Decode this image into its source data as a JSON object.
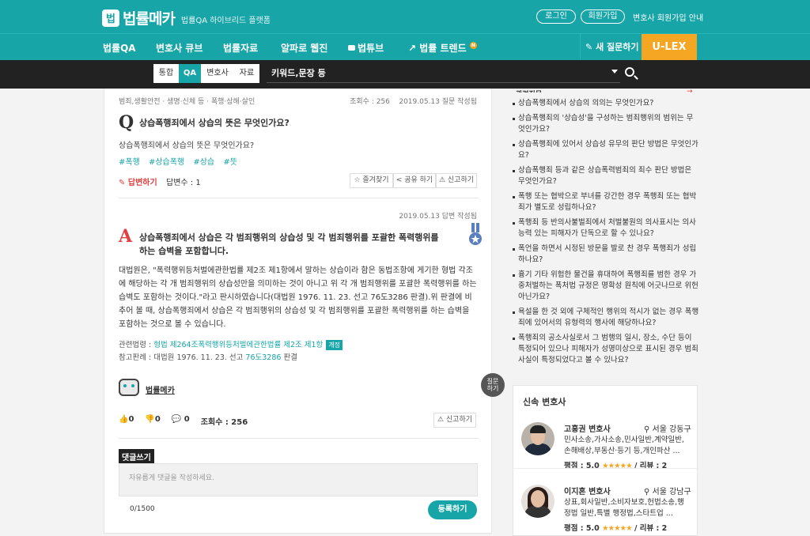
{
  "header": {
    "logo_mark": "법",
    "logo_text": "법률메카",
    "logo_sub": "법률QA 하이브리드 플랫폼",
    "login": "로그인",
    "signup": "회원가입",
    "lawyer_signup": "변호사 회원가입 안내"
  },
  "nav": {
    "items": [
      "법률QA",
      "변호사 큐브",
      "법률자료",
      "알파로 웹진",
      "법튜브",
      "법률 트렌드"
    ],
    "new_badge": "N",
    "write": "새 질문하기",
    "ulex": "U-LEX"
  },
  "search": {
    "tabs": [
      "통합",
      "QA",
      "변호사",
      "자료"
    ],
    "active_tab": "QA",
    "placeholder": "키워드,문장 등"
  },
  "question": {
    "breadcrumb": "범죄,생활안전 · 생명·신체 등 · 폭행·상해·살인",
    "views": "조회수 : 256",
    "date": "2019.05.13 질문 작성됨",
    "mark": "Q",
    "title": "상습폭행죄에서 상습의 뜻은 무엇인가요?",
    "body": "상습폭행죄에서 상습의 뜻은 무엇인가요?",
    "tags": [
      "#폭행",
      "#상습폭행",
      "#상습",
      "#뜻"
    ],
    "answer_btn": "답변하기",
    "answer_count": "답변수 : 1",
    "bookmark": "즐겨찾기",
    "share": "공유 하기",
    "report": "신고하기"
  },
  "answer": {
    "date": "2019.05.13 답변 작성됨",
    "mark": "A",
    "title": "상습폭행죄에서 상습은 각 범죄행위의 상습성 및 각 범죄행위를 포괄한 폭력행위를 하는 습벽을 포함합니다.",
    "body": "대법원은, \"폭력행위등처벌에관한법률 제2조 제1항에서 말하는 상습이라 함은 동법조항에 게기한 형법 각조에 해당하는 각 개 범죄행위의 상습성만을 의미하는 것이 아니고 위 각 개 범죄행위를 포괄한 폭력행위를 하는 습벽도 포함하는 것이다.\"라고 판시하였습니다(대법원 1976. 11. 23. 선고 76도3286 판결).위 판결에 비추어 볼 때, 상습폭행죄에서 상습은 각 범죄행위의 상습성 및 각 범죄행위를 포괄한 폭력행위를 하는 습벽을 포함하는 것으로 볼 수 있습니다.",
    "law_label": "관련법령 : ",
    "law_link": "형법 제264조폭력행위등처벌에관한법률 제2조 제1항",
    "law_badge": "개정",
    "case_label": "참고판례 : 대법원 1976. 11. 23. 선고 ",
    "case_link": "76도3286",
    "case_suffix": " 판결",
    "author": "법률메카",
    "likes": "0",
    "dislikes": "0",
    "comments": "0",
    "views": "조회수 : 256",
    "report": "신고하기"
  },
  "comment": {
    "label": "댓글쓰기",
    "placeholder": "자유롭게 댓글을 작성하세요.",
    "count": "0/1500",
    "submit": "등록하기"
  },
  "fab": {
    "line1": "질문",
    "line2": "하기"
  },
  "sidebar": {
    "heading": "관련질문",
    "questions": [
      "상습폭행죄에서 상습의 의의는 무엇인가요?",
      "상습폭행죄의 '상습성'을 구성하는 범죄행위의 범위는 무엇인가요?",
      "상습폭행죄에 있어서 상습성 유무의 판단 방법은 무엇인가요?",
      "상습폭행죄 등과 같은 상습폭력범죄의 죄수 판단 방법은 무엇인가요?",
      "폭행 또는 협박으로 부녀를 강간한 경우 폭행죄 또는 협박죄가 별도로 성립하나요?",
      "폭행죄 등 반의사불벌죄에서 처벌불원의 의사표시는 의사능력 있는 피해자가 단독으로 할 수 있나요?",
      "폭언을 하면서 시정된 방문을 발로 찬 경우 폭행죄가 성립하나요?",
      "흉기 기타 위험한 물건을 휴대하여 폭행죄를 범한 경우 가중처벌하는 폭처법 규정은 명확성 원칙에 어긋나므로 위헌 아닌가요?",
      "욕설을 한 것 외에 구체적인 행위의 적시가 없는 경우 폭행죄에 있어서의 유형력의 행사에 해당하나요?",
      "폭행죄의 공소사실로서 그 범행의 일시, 장소, 수단 등이 특정되어 있으나 피해자가 성명미상으로 표시된 경우 범죄사실이 특정되었다고 볼 수 있나요?"
    ],
    "lawyers_title": "신속 변호사",
    "lawyers": [
      {
        "name": "고흥권 변호사",
        "location": "서울 강동구",
        "specialty": "민사소송,가사소송,민사일반,계약일반,손해배상,부동산·등기 등,개인파산 ...",
        "rating": "평점 : 5.0",
        "stars": "★★★★★",
        "reviews": "리뷰 : 2"
      },
      {
        "name": "이지혼 변호사",
        "location": "서울 강남구",
        "specialty": "상표,회사일반,소비자보호,헌법소송,행정법 일반,특별 행정법,스타트업 ...",
        "rating": "평점 : 5.0",
        "stars": "★★★★★",
        "reviews": "리뷰 : 2"
      }
    ]
  },
  "colors": {
    "brand": "#17a5a8",
    "accent": "#f5a623",
    "alert": "#e04040"
  }
}
